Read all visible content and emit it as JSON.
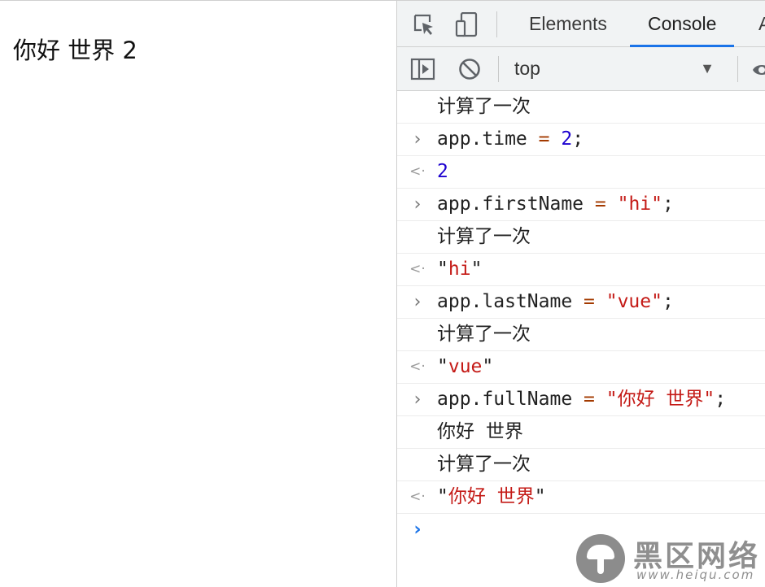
{
  "page": {
    "text": "你好 世界 2"
  },
  "devtools": {
    "tabs": [
      {
        "label": "Elements",
        "active": false
      },
      {
        "label": "Console",
        "active": true
      },
      {
        "label": "A",
        "active": false
      }
    ],
    "toolbar": {
      "context": "top"
    },
    "console": {
      "entries": [
        {
          "kind": "log",
          "text": "计算了一次"
        },
        {
          "kind": "input",
          "segments": [
            {
              "t": "app.time ",
              "c": "code"
            },
            {
              "t": "=",
              "c": "op"
            },
            {
              "t": " ",
              "c": "code"
            },
            {
              "t": "2",
              "c": "num"
            },
            {
              "t": ";",
              "c": "code"
            }
          ]
        },
        {
          "kind": "result-num",
          "text": "2"
        },
        {
          "kind": "input",
          "segments": [
            {
              "t": "app.firstName ",
              "c": "code"
            },
            {
              "t": "=",
              "c": "op"
            },
            {
              "t": " ",
              "c": "code"
            },
            {
              "t": "\"hi\"",
              "c": "str"
            },
            {
              "t": ";",
              "c": "code"
            }
          ]
        },
        {
          "kind": "log",
          "text": "计算了一次"
        },
        {
          "kind": "result-str",
          "text": "hi"
        },
        {
          "kind": "input",
          "segments": [
            {
              "t": "app.lastName ",
              "c": "code"
            },
            {
              "t": "=",
              "c": "op"
            },
            {
              "t": " ",
              "c": "code"
            },
            {
              "t": "\"vue\"",
              "c": "str"
            },
            {
              "t": ";",
              "c": "code"
            }
          ]
        },
        {
          "kind": "log",
          "text": "计算了一次"
        },
        {
          "kind": "result-str",
          "text": "vue"
        },
        {
          "kind": "input",
          "segments": [
            {
              "t": "app.fullName ",
              "c": "code"
            },
            {
              "t": "=",
              "c": "op"
            },
            {
              "t": " ",
              "c": "code"
            },
            {
              "t": "\"你好 世界\"",
              "c": "str"
            },
            {
              "t": ";",
              "c": "code"
            }
          ]
        },
        {
          "kind": "log",
          "text": "你好 世界"
        },
        {
          "kind": "log",
          "text": "计算了一次"
        },
        {
          "kind": "result-str",
          "text": "你好 世界"
        }
      ]
    }
  },
  "watermark": {
    "title": "黑区网络",
    "url": "www.heiqu.com"
  },
  "colors": {
    "accent": "#1a73e8",
    "string": "#c41a16",
    "number": "#1c00cf",
    "operator": "#a33a00"
  },
  "icons": {
    "inspect": "inspect-element-icon",
    "device": "device-toolbar-icon",
    "sidebar": "show-sidebar-icon",
    "clear": "clear-console-icon",
    "dropdown": "chevron-down-icon",
    "eye": "eye-icon",
    "input": "input-chevron-icon",
    "output": "output-arrow-icon",
    "prompt": "prompt-chevron-icon"
  }
}
